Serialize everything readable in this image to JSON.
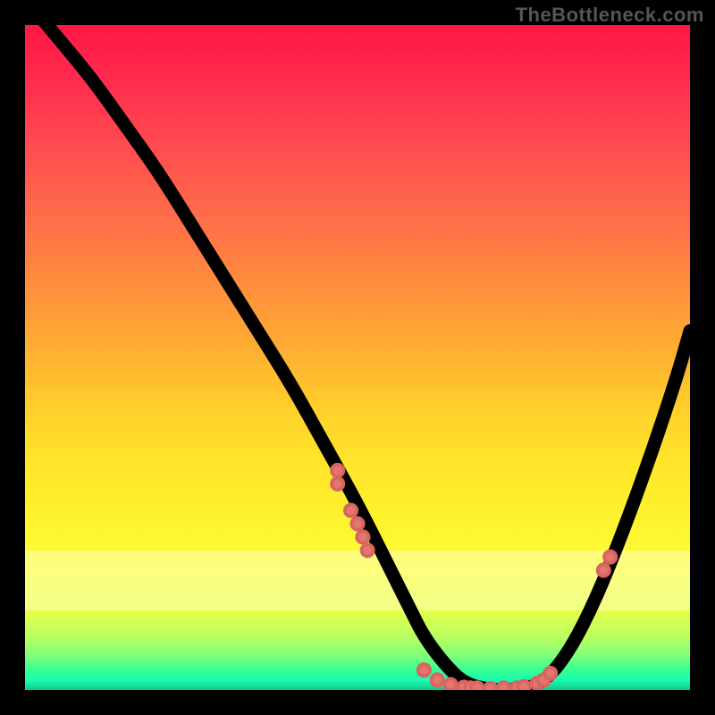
{
  "watermark": "TheBottleneck.com",
  "chart_data": {
    "type": "line",
    "title": "",
    "xlabel": "",
    "ylabel": "",
    "xlim": [
      0,
      100
    ],
    "ylim": [
      0,
      100
    ],
    "grid": false,
    "series": [
      {
        "name": "curve",
        "x": [
          0,
          5,
          10,
          15,
          20,
          25,
          30,
          35,
          40,
          45,
          50,
          55,
          58,
          60,
          63,
          66,
          70,
          74,
          78,
          82,
          86,
          90,
          94,
          98,
          100
        ],
        "y": [
          104,
          98,
          92,
          85,
          78,
          70,
          62,
          54,
          46,
          37,
          28,
          18,
          12,
          8,
          4,
          1,
          0,
          0,
          1,
          6,
          14,
          24,
          35,
          47,
          54
        ]
      }
    ],
    "markers": [
      {
        "x": 47,
        "y": 33
      },
      {
        "x": 47,
        "y": 31
      },
      {
        "x": 49,
        "y": 27
      },
      {
        "x": 50,
        "y": 25
      },
      {
        "x": 50.8,
        "y": 23
      },
      {
        "x": 51.5,
        "y": 21
      },
      {
        "x": 60,
        "y": 3
      },
      {
        "x": 62,
        "y": 1.5
      },
      {
        "x": 64,
        "y": 0.8
      },
      {
        "x": 66,
        "y": 0.4
      },
      {
        "x": 67,
        "y": 0.3
      },
      {
        "x": 68,
        "y": 0.3
      },
      {
        "x": 70,
        "y": 0.2
      },
      {
        "x": 72,
        "y": 0.3
      },
      {
        "x": 74,
        "y": 0.3
      },
      {
        "x": 75,
        "y": 0.5
      },
      {
        "x": 77,
        "y": 1
      },
      {
        "x": 78,
        "y": 1.5
      },
      {
        "x": 79,
        "y": 2.5
      },
      {
        "x": 87,
        "y": 18
      },
      {
        "x": 88,
        "y": 20
      }
    ],
    "background_gradient": {
      "top": "#ff1744",
      "mid1": "#ff8a3e",
      "mid2": "#fff22d",
      "bottom": "#12c78c"
    }
  }
}
